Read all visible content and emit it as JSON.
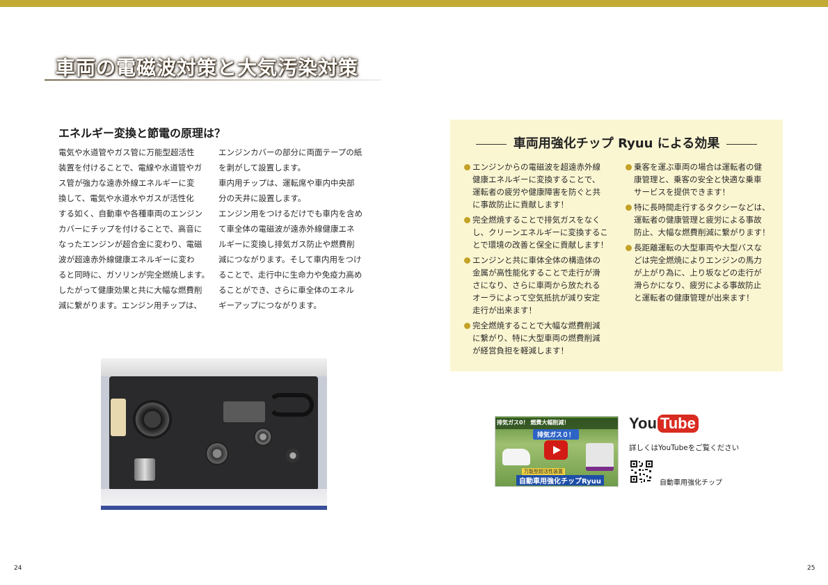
{
  "colors": {
    "top_bar": "#c3aa35",
    "effects_bg": "#fbf6d2",
    "bullet": "#c3a227",
    "youtube_red": "#d92b1f"
  },
  "header": {
    "title": "車両の電磁波対策と大気汚染対策"
  },
  "left": {
    "heading": "エネルギー変換と節電の原理は？",
    "col1_lines": [
      "電気や水道管やガス管に万能型超活性",
      "装置を付けることで、電線や水道管やガ",
      "ス管が強力な遠赤外線エネルギーに変",
      "換して、電気や水道水やガスが活性化",
      "する如く、自動車や各種車両のエンジン",
      "カバーにチップを付けることで、高音に",
      "なったエンジンが超合金に変わり、電磁",
      "波が超遠赤外線健康エネルギーに変わ",
      "ると同時に、ガソリンが完全燃焼します。",
      "したがって健康効果と共に大幅な燃費削",
      "減に繋がります。エンジン用チップは、"
    ],
    "col2_lines": [
      "エンジンカバーの部分に両面テープの紙",
      "を剥がして設置します。",
      "車内用チップは、運転席や車内中央部",
      "分の天井に設置します。",
      "エンジン用をつけるだけでも車内を含め",
      "て車全体の電磁波が遠赤外線健康エネ",
      "ルギーに変換し排気ガス防止や燃費削",
      "減につながります。そして車内用をつけ",
      "ることで、走行中に生命力や免疫力高め",
      "ることができ、さらに車全体のエネル",
      "ギーアップにつながります。"
    ],
    "photo_icon": "engine-bay-photo"
  },
  "effects": {
    "title": "車両用強化チップ Ryuu による効果",
    "col1": [
      {
        "lines": [
          "エンジンからの電磁波を超遠赤外線",
          "健康エネルギーに変換することで、",
          "運転者の疲労や健康障害を防ぐと共",
          "に事故防止に貢献します！"
        ]
      },
      {
        "lines": [
          "完全燃焼することで排気ガスをなく",
          "し、クリーンエネルギーに変換するこ",
          "とで環境の改善と保全に貢献します！"
        ]
      },
      {
        "lines": [
          "エンジンと共に車体全体の構造体の",
          "金属が高性能化することで走行が滑",
          "さになり、さらに車両から放たれる",
          "オーラによって空気抵抗が減り安定",
          "走行が出来ます！"
        ]
      },
      {
        "lines": [
          "完全燃焼することで大幅な燃費削減",
          "に繋がり、特に大型車両の燃費削減",
          "が経営負担を軽減します！"
        ]
      }
    ],
    "col2": [
      {
        "lines": [
          "乗客を運ぶ車両の場合は運転者の健",
          "康管理と、乗客の安全と快適な乗車",
          "サービスを提供できます！"
        ]
      },
      {
        "lines": [
          "特に長時間走行するタクシーなどは、",
          "運転者の健康管理と疲労による事故",
          "防止、大幅な燃費削減に繋がります！"
        ]
      },
      {
        "lines": [
          "長距離運転の大型車両や大型バスな",
          "どは完全燃焼によりエンジンの馬力",
          "が上がり為に、上り坂などの走行が",
          "滑らかになり、疲労による事故防止",
          "と運転者の健康管理が出来ます！"
        ]
      }
    ]
  },
  "video": {
    "banner": "排気ガス0！ 燃費大幅削減！",
    "tag": "排気ガス０！",
    "sub": "万能型超活性装置",
    "main": "自動車用強化チップRyuu"
  },
  "youtube": {
    "logo_you": "You",
    "logo_tube": "Tube",
    "caption": "詳しくはYouTubeをご覧ください",
    "qr_label": "自動車用強化チップ"
  },
  "pages": {
    "left": "24",
    "right": "25"
  }
}
